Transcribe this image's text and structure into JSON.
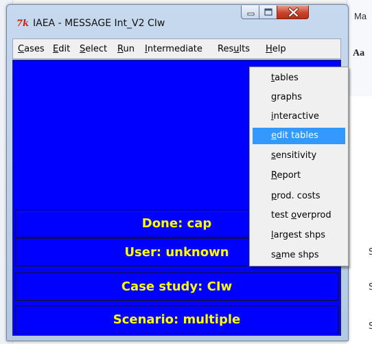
{
  "window": {
    "title": "IAEA - MESSAGE Int_V2 CIw",
    "app_icon_glyph": "7k"
  },
  "background_app": {
    "title_snippet": "Ma",
    "ribbon_glyph": "Aa",
    "side_letter": "S"
  },
  "menubar": {
    "items": [
      {
        "mnemonic": "C",
        "rest": "ases"
      },
      {
        "mnemonic": "E",
        "rest": "dit"
      },
      {
        "mnemonic": "S",
        "rest": "elect"
      },
      {
        "mnemonic": "R",
        "rest": "un"
      },
      {
        "mnemonic": "I",
        "rest": "ntermediate"
      },
      {
        "pre": "Res",
        "mnemonic": "u",
        "rest": "lts"
      },
      {
        "mnemonic": "H",
        "rest": "elp"
      }
    ]
  },
  "status": {
    "done": "Done: cap",
    "user": "User: unknown",
    "case_study": "Case study: CIw",
    "scenario": "Scenario: multiple"
  },
  "results_menu": {
    "items": [
      {
        "pre": "",
        "mnemonic": "t",
        "rest": "ables"
      },
      {
        "pre": "",
        "mnemonic": "g",
        "rest": "raphs"
      },
      {
        "pre": "",
        "mnemonic": "i",
        "rest": "nteractive"
      },
      {
        "pre": "",
        "mnemonic": "e",
        "rest": "dit tables"
      },
      {
        "pre": "",
        "mnemonic": "s",
        "rest": "ensitivity"
      },
      {
        "pre": "",
        "mnemonic": "R",
        "rest": "eport"
      },
      {
        "pre": "",
        "mnemonic": "p",
        "rest": "rod. costs"
      },
      {
        "pre": "test ",
        "mnemonic": "o",
        "rest": "verprod"
      },
      {
        "pre": "",
        "mnemonic": "l",
        "rest": "argest shps"
      },
      {
        "pre": "s",
        "mnemonic": "a",
        "rest": "me shps"
      }
    ],
    "highlighted_index": 3
  },
  "colors": {
    "content_bg": "#0000ff",
    "status_text": "#ffff00",
    "highlight": "#3399ff",
    "close_button": "#c9452d"
  }
}
